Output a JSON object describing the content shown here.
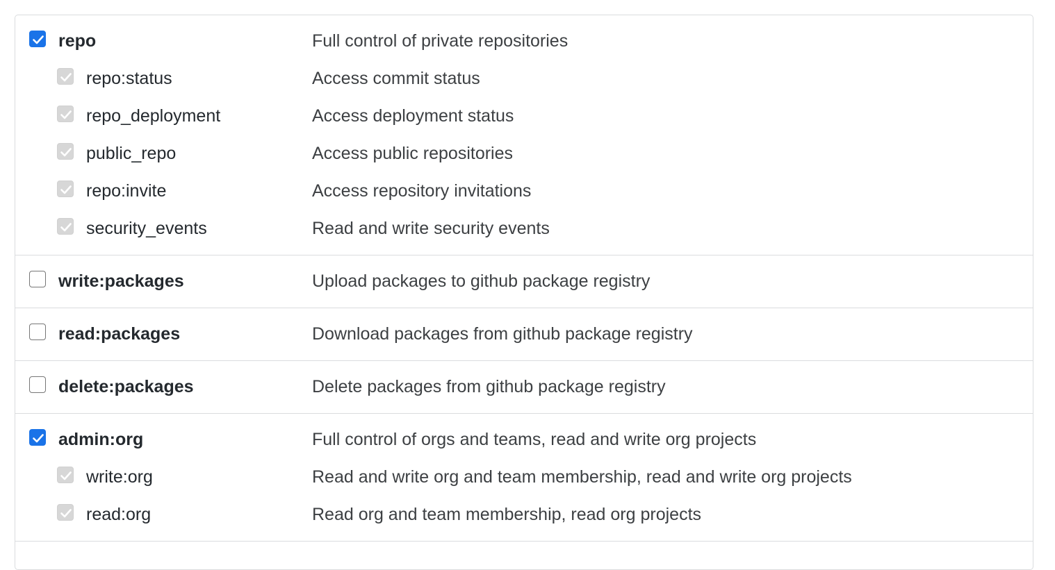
{
  "scopes": [
    {
      "name": "repo",
      "description": "Full control of private repositories",
      "checked": true,
      "children": [
        {
          "name": "repo:status",
          "description": "Access commit status"
        },
        {
          "name": "repo_deployment",
          "description": "Access deployment status"
        },
        {
          "name": "public_repo",
          "description": "Access public repositories"
        },
        {
          "name": "repo:invite",
          "description": "Access repository invitations"
        },
        {
          "name": "security_events",
          "description": "Read and write security events"
        }
      ]
    },
    {
      "name": "write:packages",
      "description": "Upload packages to github package registry",
      "checked": false,
      "children": []
    },
    {
      "name": "read:packages",
      "description": "Download packages from github package registry",
      "checked": false,
      "children": []
    },
    {
      "name": "delete:packages",
      "description": "Delete packages from github package registry",
      "checked": false,
      "children": []
    },
    {
      "name": "admin:org",
      "description": "Full control of orgs and teams, read and write org projects",
      "checked": true,
      "children": [
        {
          "name": "write:org",
          "description": "Read and write org and team membership, read and write org projects"
        },
        {
          "name": "read:org",
          "description": "Read org and team membership, read org projects"
        }
      ]
    }
  ],
  "colors": {
    "checkbox_checked": "#1a73e8",
    "checkbox_disabled": "#d7d7d7",
    "border": "#dadcde",
    "text": "#24292e",
    "description_text": "#3d4043"
  }
}
